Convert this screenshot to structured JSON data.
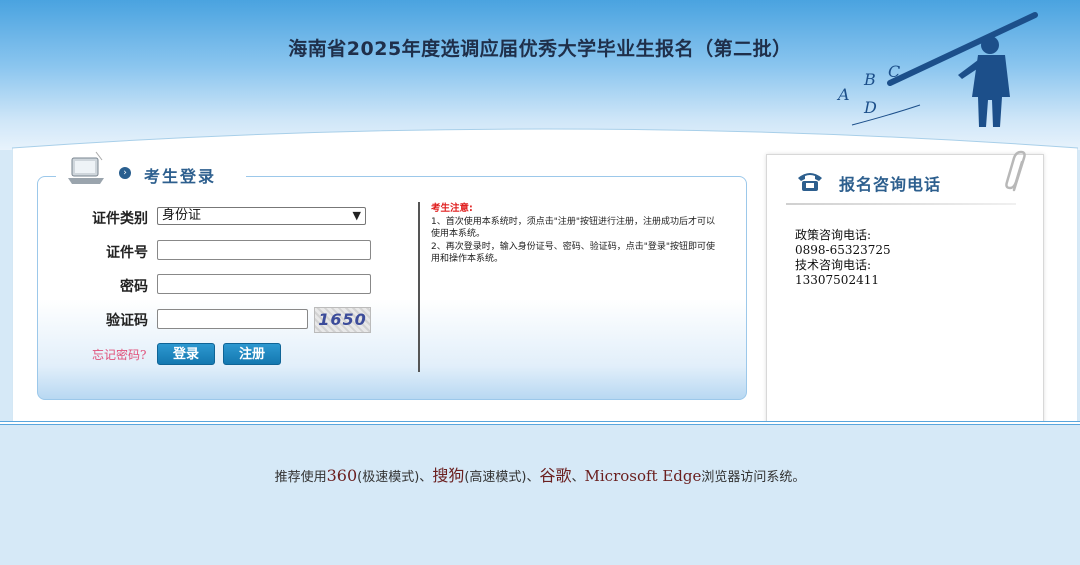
{
  "header": {
    "title": "海南省2025年度选调应届优秀大学毕业生报名（第二批）",
    "art_letters": [
      "A",
      "B",
      "C",
      "D"
    ]
  },
  "login": {
    "title": "考生登录",
    "fields": {
      "id_type_label": "证件类别",
      "id_type_value": "身份证",
      "id_number_label": "证件号",
      "password_label": "密码",
      "captcha_label": "验证码",
      "captcha_text": "1650"
    },
    "forgot_label": "忘记密码?",
    "login_button": "登录",
    "register_button": "注册"
  },
  "notice": {
    "title": "考生注意:",
    "items": [
      "1、首次使用本系统时，须点击\"注册\"按钮进行注册，注册成功后才可以使用本系统。",
      "2、再次登录时，输入身份证号、密码、验证码，点击\"登录\"按钮即可使用和操作本系统。"
    ]
  },
  "contact": {
    "title": "报名咨询电话",
    "policy_label": "政策咨询电话:",
    "policy_phone": "0898-65323725",
    "tech_label": "技术咨询电话:",
    "tech_phone": "13307502411"
  },
  "footer": {
    "prefix": "推荐使用",
    "b1": "360",
    "m1": "(极速模式)、",
    "b2": "搜狗",
    "m2": "(高速模式)、",
    "b3": "谷歌",
    "sep": "、",
    "b4": "Microsoft Edge",
    "suffix": "浏览器访问系统。"
  },
  "colors": {
    "accent": "#2d5f8e",
    "button": "#1478b0",
    "notice_title": "#e02020",
    "forgot": "#e0507a"
  }
}
